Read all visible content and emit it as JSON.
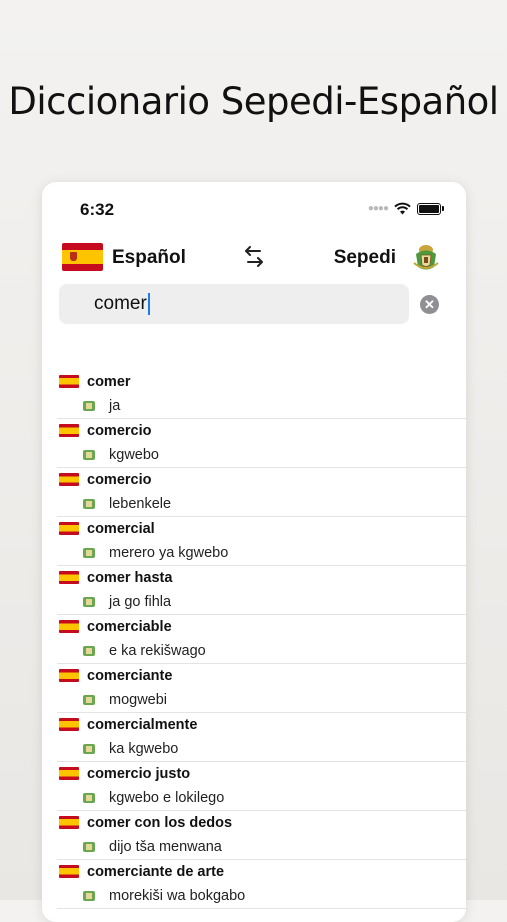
{
  "banner": {
    "title": "Diccionario Sepedi-Español"
  },
  "status_bar": {
    "time": "6:32"
  },
  "lang_bar": {
    "source": "Español",
    "target": "Sepedi",
    "swap_icon": "swap-arrows-icon"
  },
  "search": {
    "value": "comer"
  },
  "results": [
    {
      "word": "comer",
      "translation": "ja"
    },
    {
      "word": "comercio",
      "translation": "kgwebo"
    },
    {
      "word": "comercio",
      "translation": "lebenkele"
    },
    {
      "word": "comercial",
      "translation": "merero ya kgwebo"
    },
    {
      "word": "comer hasta",
      "translation": "ja go fihla"
    },
    {
      "word": "comerciable",
      "translation": "e ka rekišwago"
    },
    {
      "word": "comerciante",
      "translation": "mogwebi"
    },
    {
      "word": "comercialmente",
      "translation": "ka kgwebo"
    },
    {
      "word": "comercio justo",
      "translation": "kgwebo e lokilego"
    },
    {
      "word": "comer con los dedos",
      "translation": "dijo tša menwana"
    },
    {
      "word": "comerciante de arte",
      "translation": "morekiši wa bokgabo"
    }
  ],
  "colors": {
    "accent_caret": "#1a7cf2",
    "spain_red": "#c60b1e",
    "spain_yellow": "#ffc400"
  }
}
